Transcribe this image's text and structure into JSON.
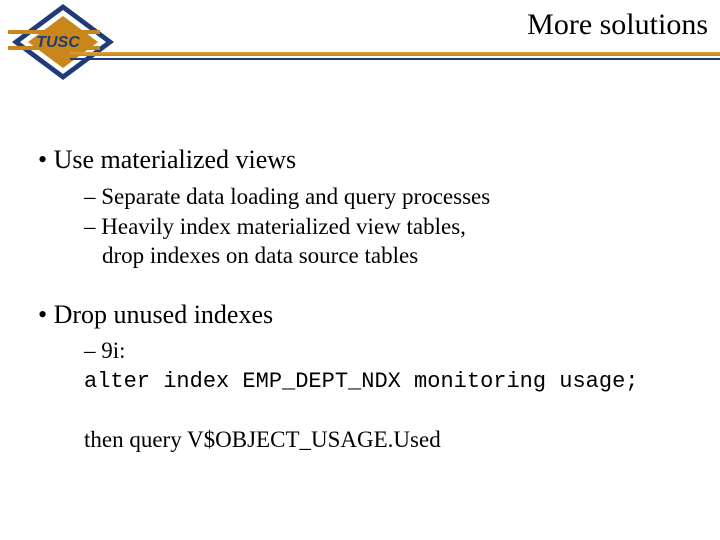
{
  "header": {
    "logo_text": "TUSC",
    "title": "More solutions"
  },
  "bullets": {
    "b1": "Use materialized views",
    "b1_sub1": "Separate data loading and query processes",
    "b1_sub2a": "Heavily index materialized view tables,",
    "b1_sub2b": "drop indexes on data source tables",
    "b2": "Drop unused indexes",
    "b2_sub1": "9i:",
    "b2_code": "alter index EMP_DEPT_NDX monitoring usage;",
    "b2_then": "then query V$OBJECT_USAGE.Used"
  }
}
